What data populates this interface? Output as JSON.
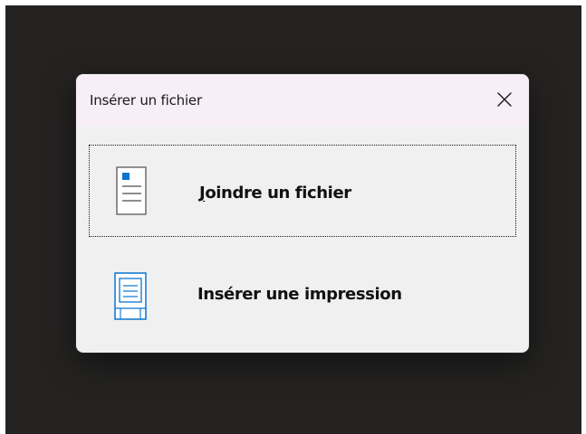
{
  "dialog": {
    "title": "Insérer un fichier",
    "close_icon": "close-icon"
  },
  "options": [
    {
      "label_prefix": "J",
      "label_rest": "oindre un fichier",
      "icon": "attachment-document-icon",
      "accent": "#0078d4",
      "focused": true
    },
    {
      "label": "Insérer une impression",
      "icon": "printout-document-icon",
      "accent": "#0078d4",
      "focused": false
    }
  ],
  "colors": {
    "background": "#242322",
    "dialog": "#f0f0f0",
    "titlebar": "#f8eef7",
    "text": "#111111",
    "accent": "#0078d4"
  }
}
